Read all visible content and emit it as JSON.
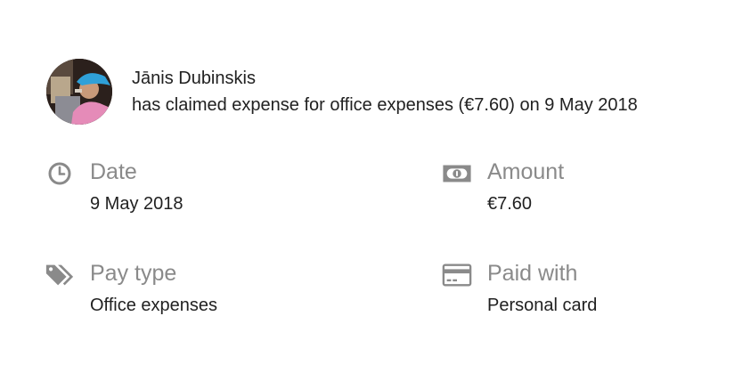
{
  "claim": {
    "user_name": "Jānis Dubinskis",
    "description": "has claimed expense for office expenses (€7.60) on 9 May 2018"
  },
  "fields": {
    "date": {
      "label": "Date",
      "value": "9 May 2018",
      "icon": "clock-icon"
    },
    "amount": {
      "label": "Amount",
      "value": "€7.60",
      "icon": "banknote-icon"
    },
    "pay_type": {
      "label": "Pay type",
      "value": "Office expenses",
      "icon": "tags-icon"
    },
    "paid_with": {
      "label": "Paid with",
      "value": "Personal card",
      "icon": "credit-card-icon"
    }
  },
  "colors": {
    "label": "#8a8a8a",
    "text": "#212121",
    "icon": "#8a8a8a"
  }
}
